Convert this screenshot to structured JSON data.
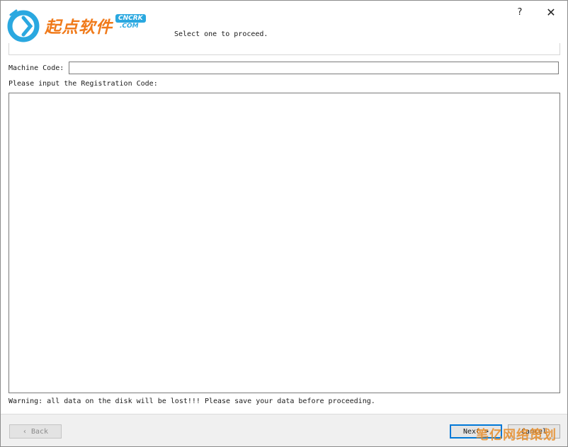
{
  "titlebar": {
    "help_glyph": "?",
    "close_glyph": "✕",
    "help_icon": "question-icon",
    "close_icon": "close-icon"
  },
  "logo": {
    "cn_text": "起点软件",
    "badge_top": "CNCRK",
    "badge_bottom": ".COM",
    "mark_colors": {
      "ring": "#2aa8e0",
      "text": "#f07a1a"
    }
  },
  "header": {
    "instruction": "Select one to proceed."
  },
  "form": {
    "machine_code_label": "Machine Code:",
    "machine_code_value": "",
    "registration_label": "Please input the Registration Code:",
    "registration_value": ""
  },
  "warning": "Warning: all data on the disk will be lost!!! Please save your data before proceeding.",
  "buttons": {
    "back": "‹ Back",
    "next": "Next >",
    "cancel": "Cancel"
  },
  "watermark": "笔亿网络策划",
  "colors": {
    "accent": "#0078d7",
    "footer_bg": "#f0f0f0"
  }
}
